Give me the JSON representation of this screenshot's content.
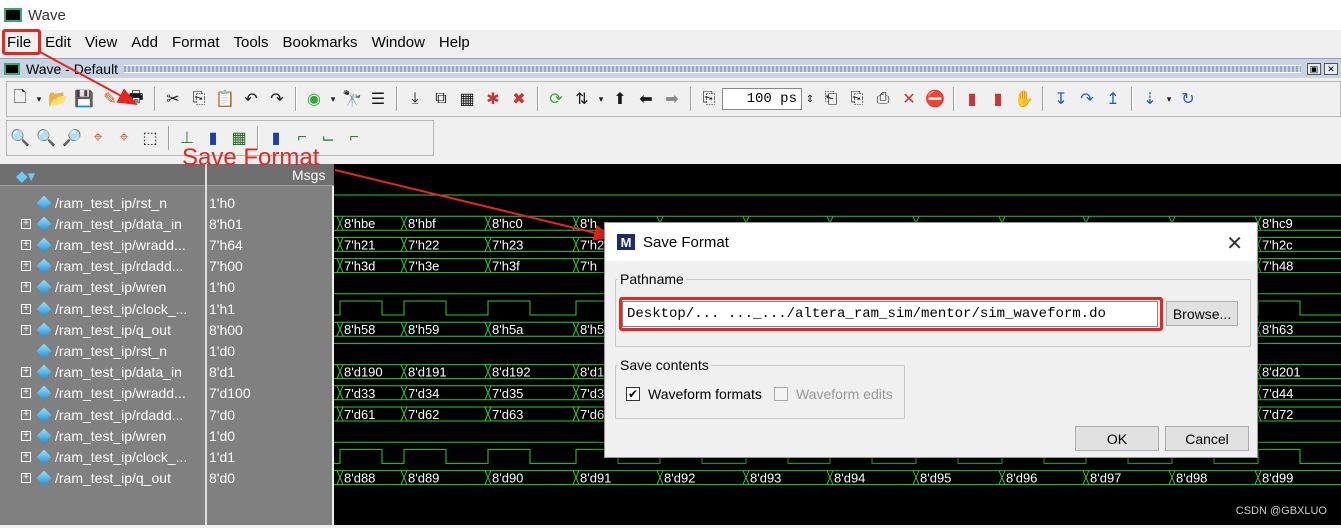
{
  "window": {
    "title": "Wave",
    "subtitle": "Wave - Default"
  },
  "menu": [
    "File",
    "Edit",
    "View",
    "Add",
    "Format",
    "Tools",
    "Bookmarks",
    "Window",
    "Help"
  ],
  "toolbar": {
    "zoom_value": "100 ps"
  },
  "panes": {
    "msgs_header": "Msgs"
  },
  "signals": [
    {
      "name": "/ram_test_ip/rst_n",
      "value": "1'h0",
      "expandable": false
    },
    {
      "name": "/ram_test_ip/data_in",
      "value": "8'h01",
      "expandable": true
    },
    {
      "name": "/ram_test_ip/wradd...",
      "value": "7'h64",
      "expandable": true
    },
    {
      "name": "/ram_test_ip/rdadd...",
      "value": "7'h00",
      "expandable": true
    },
    {
      "name": "/ram_test_ip/wren",
      "value": "1'h0",
      "expandable": true
    },
    {
      "name": "/ram_test_ip/clock_...",
      "value": "1'h1",
      "expandable": true
    },
    {
      "name": "/ram_test_ip/q_out",
      "value": "8'h00",
      "expandable": true
    },
    {
      "name": "/ram_test_ip/rst_n",
      "value": "1'd0",
      "expandable": false
    },
    {
      "name": "/ram_test_ip/data_in",
      "value": "8'd1",
      "expandable": true
    },
    {
      "name": "/ram_test_ip/wradd...",
      "value": "7'd100",
      "expandable": true
    },
    {
      "name": "/ram_test_ip/rdadd...",
      "value": "7'd0",
      "expandable": true
    },
    {
      "name": "/ram_test_ip/wren",
      "value": "1'd0",
      "expandable": true
    },
    {
      "name": "/ram_test_ip/clock_...",
      "value": "1'd1",
      "expandable": true
    },
    {
      "name": "/ram_test_ip/q_out",
      "value": "8'd0",
      "expandable": true
    }
  ],
  "wave_rows": {
    "data_in_hex": [
      "8'hbe",
      "8'hbf",
      "8'hc0",
      "8'h"
    ],
    "data_in_hex_right": "8'hc9",
    "wradd_hex": [
      "7'h21",
      "7'h22",
      "7'h23",
      "7'h2"
    ],
    "wradd_hex_right": "7'h2c",
    "rdadd_hex": [
      "7'h3d",
      "7'h3e",
      "7'h3f",
      "7'h"
    ],
    "rdadd_hex_right": "7'h48",
    "q_out_hex": [
      "8'h58",
      "8'h59",
      "8'h5a",
      "8'h5"
    ],
    "q_out_hex_right": "8'h63",
    "data_in_dec": [
      "8'd190",
      "8'd191",
      "8'd192",
      "8'd1"
    ],
    "data_in_dec_right": "8'd201",
    "wradd_dec": [
      "7'd33",
      "7'd34",
      "7'd35",
      "7'd3"
    ],
    "wradd_dec_right": "7'd44",
    "rdadd_dec": [
      "7'd61",
      "7'd62",
      "7'd63",
      "7'd6"
    ],
    "rdadd_dec_right": "7'd72",
    "q_out_dec": [
      "8'd88",
      "8'd89",
      "8'd90",
      "8'd91",
      "8'd92",
      "8'd93",
      "8'd94",
      "8'd95",
      "8'd96",
      "8'd97",
      "8'd98",
      "8'd99"
    ]
  },
  "dialog": {
    "title": "Save Format",
    "pathname_legend": "Pathname",
    "path_value": "Desktop/...  ..._.../altera_ram_sim/mentor/sim_waveform.do",
    "browse_label": "Browse...",
    "save_contents_legend": "Save contents",
    "waveform_formats_label": "Waveform formats",
    "waveform_formats_checked": true,
    "waveform_edits_label": "Waveform edits",
    "waveform_edits_checked": false,
    "ok_label": "OK",
    "cancel_label": "Cancel"
  },
  "annotation": {
    "text": "Save Format",
    "color": "#e8251f"
  },
  "watermark": "CSDN @GBXLUO"
}
